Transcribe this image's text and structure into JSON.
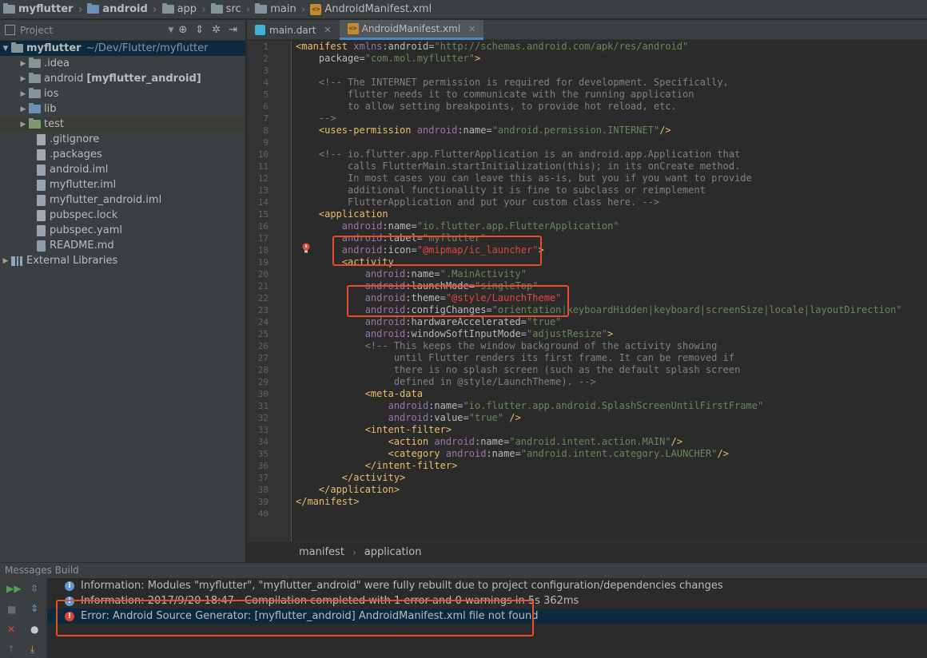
{
  "breadcrumbs": [
    "myflutter",
    "android",
    "app",
    "src",
    "main",
    "AndroidManifest.xml"
  ],
  "sidebar": {
    "title": "Project",
    "root": {
      "name": "myflutter",
      "path": "~/Dev/Flutter/myflutter"
    },
    "items": [
      {
        "label": ".idea",
        "type": "folder"
      },
      {
        "label": "android",
        "extra": "[myflutter_android]",
        "type": "module"
      },
      {
        "label": "ios",
        "type": "folder"
      },
      {
        "label": "lib",
        "type": "folder"
      },
      {
        "label": "test",
        "type": "folder"
      },
      {
        "label": ".gitignore",
        "type": "file"
      },
      {
        "label": ".packages",
        "type": "file"
      },
      {
        "label": "android.iml",
        "type": "file"
      },
      {
        "label": "myflutter.iml",
        "type": "file"
      },
      {
        "label": "myflutter_android.iml",
        "type": "file"
      },
      {
        "label": "pubspec.lock",
        "type": "file"
      },
      {
        "label": "pubspec.yaml",
        "type": "file"
      },
      {
        "label": "README.md",
        "type": "file"
      },
      {
        "label": "External Libraries",
        "type": "lib"
      }
    ]
  },
  "tabs": [
    {
      "label": "main.dart",
      "active": false
    },
    {
      "label": "AndroidManifest.xml",
      "active": true
    }
  ],
  "editor": {
    "line_count": 40,
    "code": [
      "<manifest xmlns:android=\"http://schemas.android.com/apk/res/android\"",
      "    package=\"com.mol.myflutter\">",
      "",
      "    <!-- The INTERNET permission is required for development. Specifically,",
      "         flutter needs it to communicate with the running application",
      "         to allow setting breakpoints, to provide hot reload, etc.",
      "    -->",
      "    <uses-permission android:name=\"android.permission.INTERNET\"/>",
      "",
      "    <!-- io.flutter.app.FlutterApplication is an android.app.Application that",
      "         calls FlutterMain.startInitialization(this); in its onCreate method.",
      "         In most cases you can leave this as-is, but you if you want to provide",
      "         additional functionality it is fine to subclass or reimplement",
      "         FlutterApplication and put your custom class here. -->",
      "    <application",
      "        android:name=\"io.flutter.app.FlutterApplication\"",
      "        android:label=\"myflutter\"",
      "        android:icon=\"@mipmap/ic_launcher\">",
      "        <activity",
      "            android:name=\".MainActivity\"",
      "            android:launchMode=\"singleTop\"",
      "            android:theme=\"@style/LaunchTheme\"",
      "            android:configChanges=\"orientation|keyboardHidden|keyboard|screenSize|locale|layoutDirection\"",
      "            android:hardwareAccelerated=\"true\"",
      "            android:windowSoftInputMode=\"adjustResize\">",
      "            <!-- This keeps the window background of the activity showing",
      "                 until Flutter renders its first frame. It can be removed if",
      "                 there is no splash screen (such as the default splash screen",
      "                 defined in @style/LaunchTheme). -->",
      "            <meta-data",
      "                android:name=\"io.flutter.app.android.SplashScreenUntilFirstFrame\"",
      "                android:value=\"true\" />",
      "            <intent-filter>",
      "                <action android:name=\"android.intent.action.MAIN\"/>",
      "                <category android:name=\"android.intent.category.LAUNCHER\"/>",
      "            </intent-filter>",
      "        </activity>",
      "    </application>",
      "</manifest>",
      ""
    ]
  },
  "editor_breadcrumb": [
    "manifest",
    "application"
  ],
  "bottom_panel": {
    "title": "Messages Build",
    "messages": [
      {
        "level": "info",
        "text": "Information: Modules \"myflutter\", \"myflutter_android\" were fully rebuilt due to project configuration/dependencies changes"
      },
      {
        "level": "info",
        "text": "Information: 2017/9/20 18:47 - Compilation completed with 1 error and 0 warnings in 5s 362ms"
      },
      {
        "level": "error",
        "text": "Error: Android Source Generator: [myflutter_android] AndroidManifest.xml file not found"
      }
    ]
  },
  "colors": {
    "xml_tag": "#e8bf6a",
    "xml_ns": "#9876aa",
    "xml_string": "#6a8759",
    "comment": "#808080",
    "highlight_box": "#e94f26",
    "selection": "#0d293e"
  }
}
